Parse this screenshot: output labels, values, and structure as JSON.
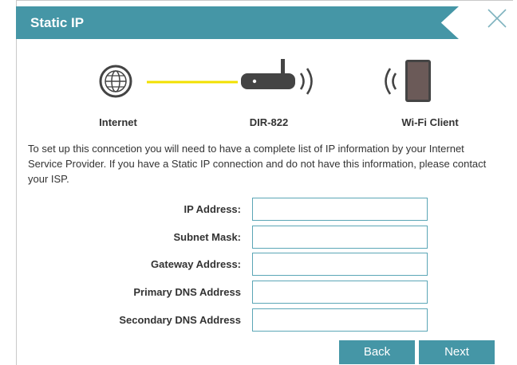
{
  "dialog": {
    "title": "Static IP"
  },
  "diagram": {
    "internet_label": "Internet",
    "router_label": "DIR-822",
    "client_label": "Wi-Fi Client",
    "link_color": "#f2e000",
    "icons": [
      "globe-icon",
      "router-icon",
      "wifi-signal-icon",
      "tablet-icon"
    ]
  },
  "description": "To set up this conncetion you will need to have a complete list of IP information by your Internet Service Provider. If you have a Static IP connection and do not have this information, please contact your ISP.",
  "form": {
    "fields": [
      {
        "label": "IP Address:",
        "value": ""
      },
      {
        "label": "Subnet Mask:",
        "value": ""
      },
      {
        "label": "Gateway Address:",
        "value": ""
      },
      {
        "label": "Primary DNS Address",
        "value": ""
      },
      {
        "label": "Secondary DNS Address",
        "value": ""
      }
    ]
  },
  "buttons": {
    "back": "Back",
    "next": "Next"
  },
  "colors": {
    "accent": "#4596a6",
    "input_border": "#5ba6b6"
  }
}
